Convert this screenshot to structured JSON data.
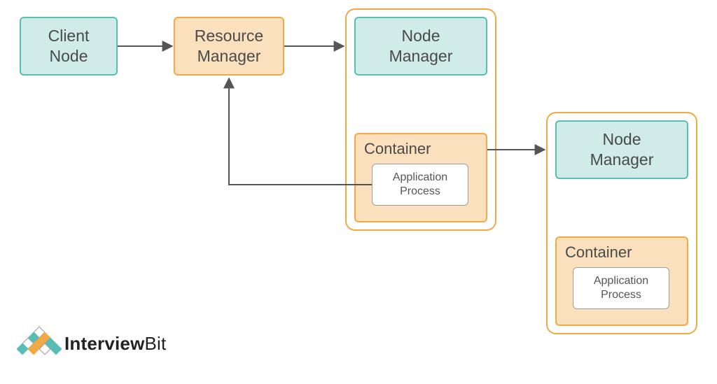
{
  "boxes": {
    "client": "Client\nNode",
    "resource_manager": "Resource\nManager",
    "node_manager_1": "Node\nManager",
    "container_1": "Container",
    "app_process_1": "Application\nProcess",
    "node_manager_2": "Node\nManager",
    "container_2": "Container",
    "app_process_2": "Application\nProcess"
  },
  "logo": {
    "brand_bold": "Interview",
    "brand_light": "Bit"
  },
  "colors": {
    "teal_fill": "#cfece9",
    "teal_border": "#58bdb5",
    "orange_fill": "#fbe0bd",
    "orange_border": "#f0a945",
    "arrow": "#555555"
  }
}
